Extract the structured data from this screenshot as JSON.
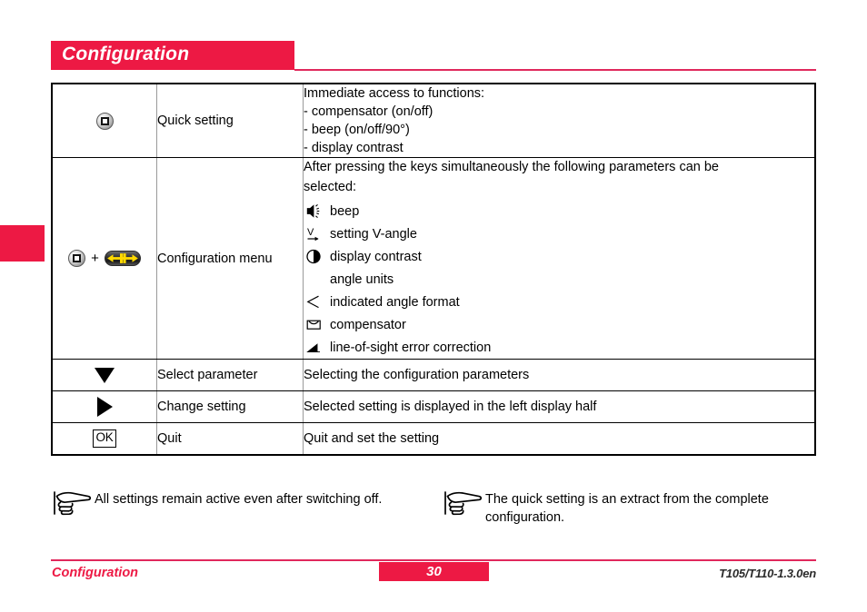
{
  "page": {
    "header_title": "Configuration",
    "accent_color": "#ED1944",
    "rule_color": "#E0285C"
  },
  "table": {
    "rows": [
      {
        "icon": "quick-setting-key-icon",
        "label": "Quick setting",
        "desc_lines": [
          "Immediate access to functions:",
          "- compensator (on/off)",
          "- beep (on/off/90°)",
          "- display contrast"
        ]
      },
      {
        "icon": "quick-setting-key-plus-horizontal-key-icon",
        "label": "Configuration menu",
        "desc_lines": [
          "After pressing the keys simultaneously the following parameters can be",
          "selected:"
        ],
        "params": [
          {
            "icon": "speaker-icon",
            "text": "beep"
          },
          {
            "icon": "v-angle-icon",
            "text": "setting V-angle"
          },
          {
            "icon": "contrast-icon",
            "text": "display contrast"
          },
          {
            "icon": "none",
            "text": "angle units"
          },
          {
            "icon": "angle-icon",
            "text": "indicated angle format"
          },
          {
            "icon": "compensator-icon",
            "text": "compensator"
          },
          {
            "icon": "line-of-sight-icon",
            "text": "line-of-sight error correction"
          }
        ]
      },
      {
        "icon": "triangle-down-icon",
        "label": "Select parameter",
        "desc_lines": [
          "Selecting the configuration parameters"
        ]
      },
      {
        "icon": "triangle-right-icon",
        "label": "Change setting",
        "desc_lines": [
          "Selected setting is displayed in the left display half"
        ]
      },
      {
        "icon": "ok-key-icon",
        "icon_text": "OK",
        "label": "Quit",
        "desc_lines": [
          "Quit and set the setting"
        ]
      }
    ]
  },
  "notes": [
    {
      "icon": "pointing-hand-icon",
      "lines": [
        "All settings remain active even after switching off."
      ]
    },
    {
      "icon": "pointing-hand-icon",
      "lines": [
        "The quick setting is an extract from the complete",
        "configuration."
      ]
    }
  ],
  "footer": {
    "left": "Configuration",
    "page_number": "30",
    "right": "T105/T110-1.3.0en"
  }
}
